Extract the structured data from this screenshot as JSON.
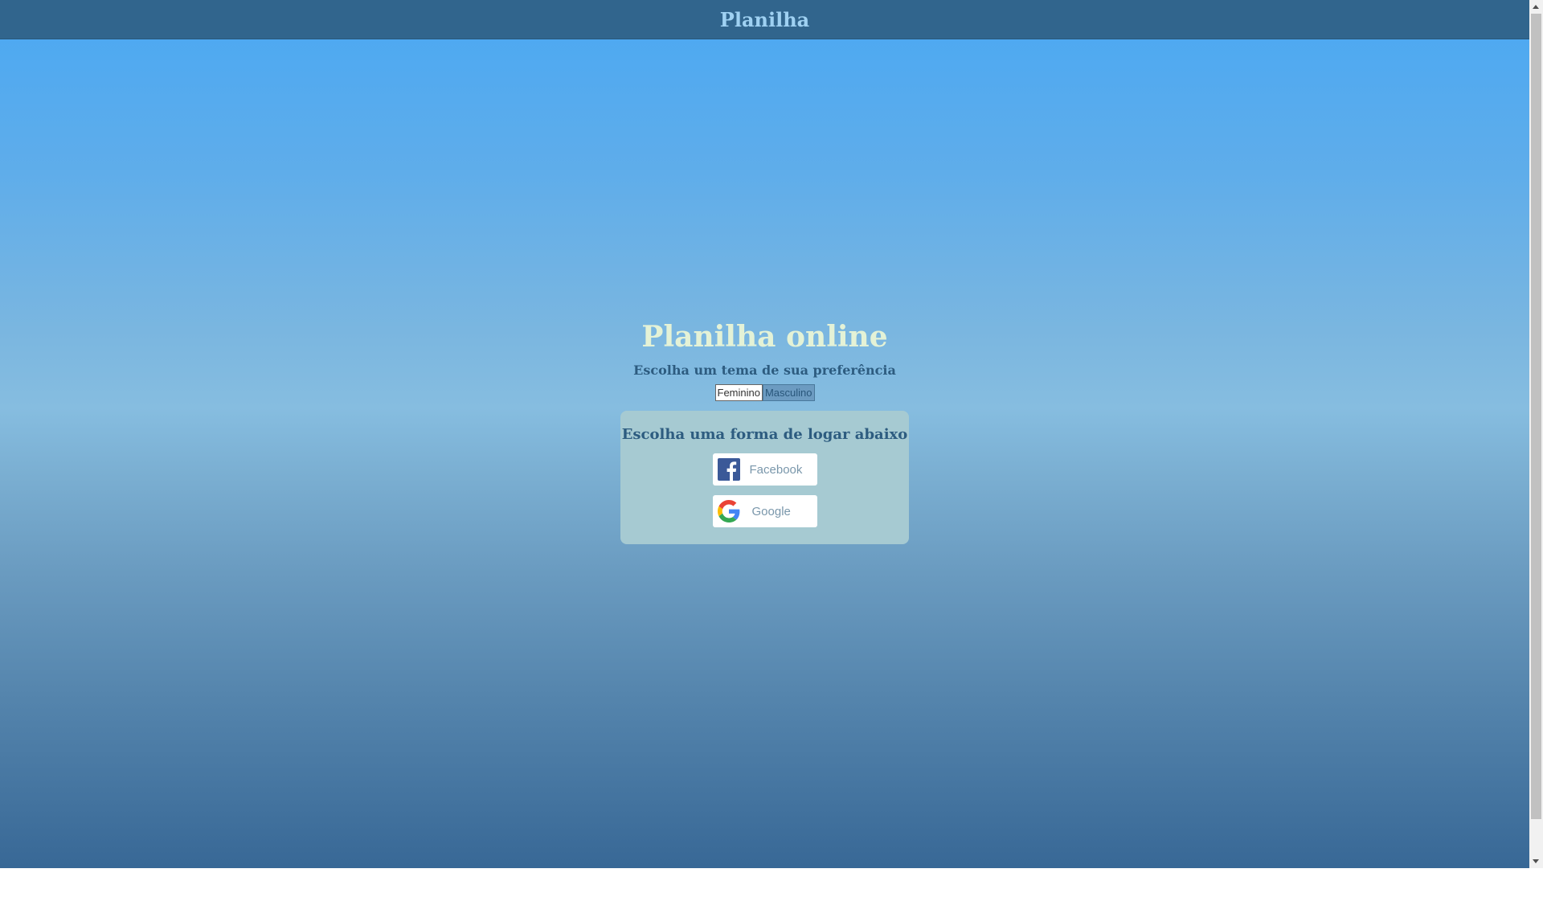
{
  "header": {
    "title": "Planilha"
  },
  "main": {
    "title": "Planilha online",
    "subtitle": "Escolha um tema de sua preferência",
    "theme_options": {
      "feminino": "Feminino",
      "masculino": "Masculino"
    }
  },
  "login": {
    "title": "Escolha uma forma de logar abaixo",
    "facebook_label": "Facebook",
    "google_label": "Google"
  },
  "colors": {
    "header_bg": "#31658d",
    "title_color": "#e4f2d6",
    "accent_text": "#2d5c80",
    "card_bg": "#a6cad2",
    "facebook_blue": "#3b5998"
  }
}
